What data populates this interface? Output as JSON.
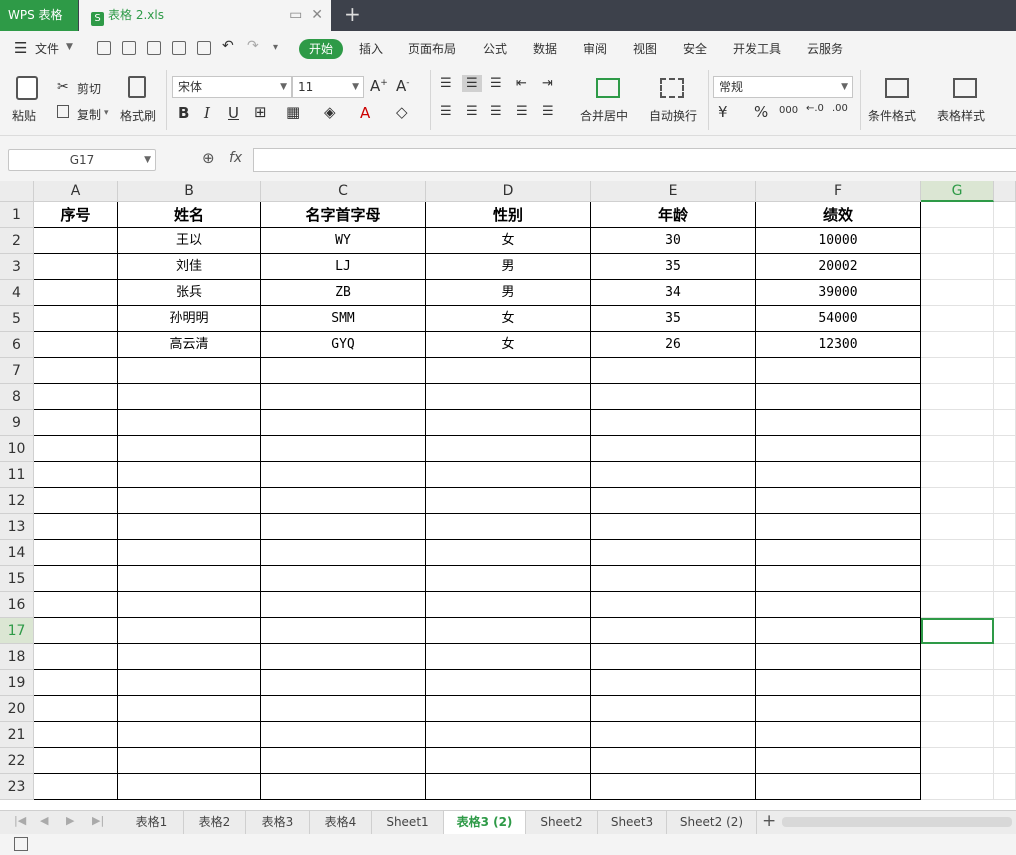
{
  "titlebar": {
    "app_name": "WPS 表格",
    "doc_icon": "S",
    "doc_title": "表格 2.xls",
    "restore_glyph": "▭",
    "close_glyph": "✕",
    "new_tab_glyph": "+"
  },
  "menubar": {
    "file_label": "文件",
    "items": [
      "开始",
      "插入",
      "页面布局",
      "公式",
      "数据",
      "审阅",
      "视图",
      "安全",
      "开发工具",
      "云服务"
    ]
  },
  "toolbar": {
    "paste": "粘贴",
    "cut": "剪切",
    "copy": "复制",
    "format_painter": "格式刷",
    "font_name": "宋体",
    "font_size": "11",
    "merge_center": "合并居中",
    "auto_wrap": "自动换行",
    "number_format": "常规",
    "percent": "%",
    "thousands": "000",
    "conditional_format": "条件格式",
    "table_style": "表格样式"
  },
  "formula_bar": {
    "name_box": "G17",
    "fx": "fx",
    "value": ""
  },
  "grid": {
    "columns": [
      "A",
      "B",
      "C",
      "D",
      "E",
      "F",
      "G"
    ],
    "header_row": [
      "序号",
      "姓名",
      "名字首字母",
      "性别",
      "年龄",
      "绩效"
    ],
    "rows": [
      [
        "",
        "王以",
        "WY",
        "女",
        "30",
        "10000"
      ],
      [
        "",
        "刘佳",
        "LJ",
        "男",
        "35",
        "20002"
      ],
      [
        "",
        "张兵",
        "ZB",
        "男",
        "34",
        "39000"
      ],
      [
        "",
        "孙明明",
        "SMM",
        "女",
        "35",
        "54000"
      ],
      [
        "",
        "高云清",
        "GYQ",
        "女",
        "26",
        "12300"
      ]
    ],
    "row_numbers": [
      "1",
      "2",
      "3",
      "4",
      "5",
      "6",
      "7",
      "8",
      "9",
      "10",
      "11",
      "12",
      "13",
      "14",
      "15",
      "16",
      "17",
      "18",
      "19",
      "20",
      "21",
      "22",
      "23"
    ],
    "selected_cell": "G17"
  },
  "sheet_tabs": {
    "tabs": [
      "表格1",
      "表格2",
      "表格3",
      "表格4",
      "Sheet1",
      "表格3 (2)",
      "Sheet2",
      "Sheet3",
      "Sheet2 (2)"
    ],
    "active": "表格3 (2)",
    "add_glyph": "+"
  },
  "colors": {
    "accent": "#2e9a47",
    "titlebar": "#3d414b"
  }
}
